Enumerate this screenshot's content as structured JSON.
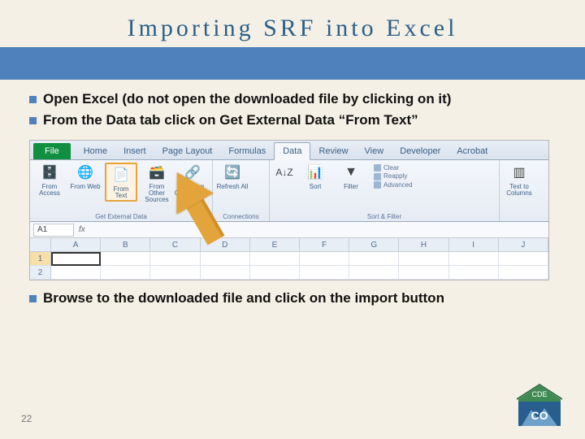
{
  "title": "Importing SRF into Excel",
  "bullets": {
    "b1": "Open Excel (do not open the downloaded file by clicking on it)",
    "b2": "From the Data tab click on Get External Data “From Text”",
    "b3": "Browse to the downloaded file and click on the import button"
  },
  "pageNumber": "22",
  "excel": {
    "fileTab": "File",
    "tabs": {
      "home": "Home",
      "insert": "Insert",
      "pageLayout": "Page Layout",
      "formulas": "Formulas",
      "data": "Data",
      "review": "Review",
      "view": "View",
      "developer": "Developer",
      "acrobat": "Acrobat"
    },
    "ribbon": {
      "getExternalData": {
        "label": "Get External Data",
        "fromAccess": "From Access",
        "fromWeb": "From Web",
        "fromText": "From Text",
        "fromOther": "From Other Sources",
        "existing": "Existing Connections"
      },
      "connections": {
        "label": "Connections",
        "refreshAll": "Refresh All"
      },
      "sortFilter": {
        "label": "Sort & Filter",
        "sort": "Sort",
        "filter": "Filter",
        "clear": "Clear",
        "reapply": "Reapply",
        "advanced": "Advanced"
      },
      "dataTools": {
        "textToColumns": "Text to Columns"
      }
    },
    "nameBox": "A1",
    "fx": "fx",
    "cols": {
      "A": "A",
      "B": "B",
      "C": "C",
      "D": "D",
      "E": "E",
      "F": "F",
      "G": "G",
      "H": "H",
      "I": "I",
      "J": "J"
    },
    "rows": {
      "r1": "1",
      "r2": "2"
    }
  },
  "logo": {
    "top": "CDE",
    "bottom": "CO"
  }
}
